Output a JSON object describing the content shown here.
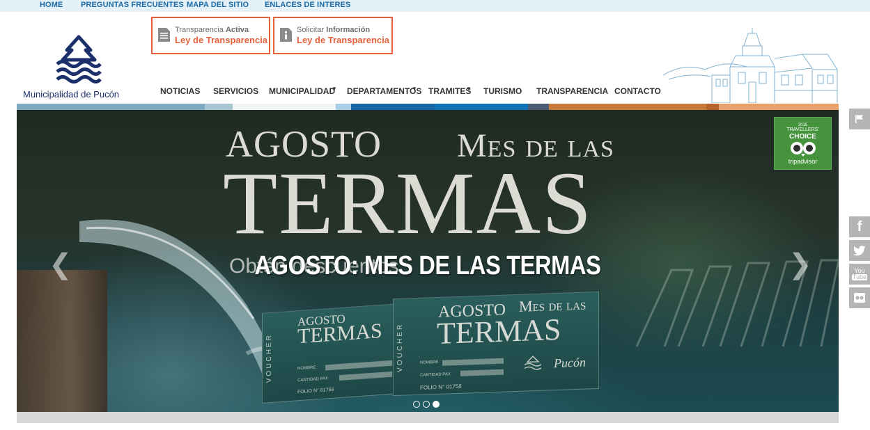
{
  "topbar": {
    "links": [
      "HOME",
      "PREGUNTAS FRECUENTES",
      "MAPA DEL SITIO",
      "ENLACES DE INTERES"
    ]
  },
  "logo": {
    "name": "Municipalidad de Pucón",
    "color": "#1b2f6b"
  },
  "transparency": [
    {
      "prefix": "Transparencia",
      "strong": "Activa",
      "label": "Ley de Transparencia"
    },
    {
      "prefix": "Solicitar",
      "strong": "Información",
      "label": "Ley de Transparencia"
    }
  ],
  "nav": {
    "items": [
      {
        "label": "NOTICIAS",
        "dropdown": false
      },
      {
        "label": "SERVICIOS",
        "dropdown": false
      },
      {
        "label": "MUNICIPALIDAD",
        "dropdown": true
      },
      {
        "label": "DEPARTAMENTOS",
        "dropdown": true
      },
      {
        "label": "TRAMITES",
        "dropdown": true
      },
      {
        "label": "TURISMO",
        "dropdown": false
      },
      {
        "label": "TRANSPARENCIA",
        "dropdown": false
      },
      {
        "label": "CONTACTO",
        "dropdown": false
      }
    ]
  },
  "hero": {
    "bg_text_1": "AGOSTO",
    "bg_text_2": "Mes de las",
    "bg_text_3": "TERMAS",
    "bg_subline": "Obtén descuentos",
    "title": "AGOSTO: MES DE LAS TERMAS",
    "prev_icon": "chevron-left-icon",
    "next_icon": "chevron-right-icon",
    "slides_total": 3,
    "slide_active": 3,
    "voucher": {
      "tag": "VOUCHER",
      "word1": "AGOSTO",
      "word2": "Mes de las",
      "word3": "TERMAS",
      "nombre": "NOMBRE",
      "cantidad": "CANTIDAD PAX",
      "folio": "FOLIO N° 01758",
      "brand": "Pucón"
    },
    "badge": {
      "year": "2015",
      "line1": "TRAVELLERS'",
      "line2": "CHOICE",
      "brand": "tripadvisor"
    }
  },
  "side": {
    "icons": [
      "flag-icon",
      "facebook-icon",
      "twitter-icon",
      "youtube-icon",
      "flickr-icon"
    ],
    "facebook": "f",
    "youtube_top": "You",
    "youtube_bottom": "Tube"
  },
  "colors": {
    "accent": "#e3603b",
    "link": "#1a6aa8",
    "band": [
      "#7fa9c0",
      "#a9c6d3",
      "#eef3f6",
      "#a8cfe6",
      "#1565a4",
      "#0e72b4",
      "#4a5a72",
      "#c87a3a",
      "#b8632c",
      "#e9a16b"
    ]
  }
}
